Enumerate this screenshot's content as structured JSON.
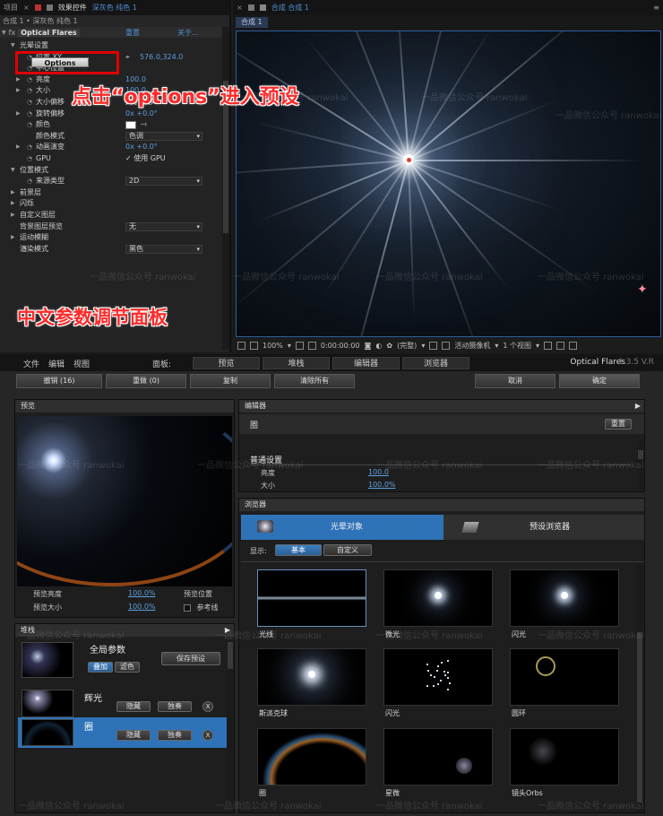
{
  "ae": {
    "tabs": {
      "project": "项目",
      "effect_controls_prefix": "效果控件",
      "effect_controls_layer": "深灰色 纯色 1"
    },
    "subtitle": "合成 1 • 深灰色 纯色 1",
    "fx": {
      "name": "Optical Flares",
      "reset": "重置",
      "about": "关于..."
    },
    "options_label": "Options",
    "params": [
      {
        "label": "光晕设置",
        "level": 1,
        "twirl": "open"
      },
      {
        "label": "位置 XY",
        "value": "576.0,324.0",
        "level": 2,
        "sw": true
      },
      {
        "label": "中心位置",
        "value": "",
        "level": 2,
        "sw": true
      },
      {
        "label": "亮度",
        "value": "100.0",
        "level": 2,
        "twirl": "closed",
        "sw": true
      },
      {
        "label": "大小",
        "value": "100.0",
        "level": 2,
        "twirl": "closed",
        "sw": true
      },
      {
        "label": "大小偏移",
        "value": "大小偏移",
        "level": 2,
        "sw": true,
        "white": true
      },
      {
        "label": "旋转偏移",
        "value": "0x +0.0°",
        "level": 2,
        "twirl": "closed",
        "sw": true
      },
      {
        "label": "颜色",
        "value": "",
        "level": 2,
        "sw": true
      },
      {
        "label": "颜色模式",
        "dropdown": "色调",
        "level": 2
      },
      {
        "label": "动画演变",
        "value": "0x +0.0°",
        "level": 2,
        "twirl": "closed",
        "sw": true
      },
      {
        "label": "GPU",
        "value": "✓ 使用 GPU",
        "level": 2,
        "sw": true,
        "white": true
      },
      {
        "label": "位置模式",
        "level": 1,
        "twirl": "open"
      },
      {
        "label": "来源类型",
        "dropdown": "2D",
        "level": 2,
        "sw": true
      },
      {
        "label": "前景层",
        "level": 1,
        "twirl": "closed"
      },
      {
        "label": "闪烁",
        "level": 1,
        "twirl": "closed"
      },
      {
        "label": "自定义图层",
        "level": 1,
        "twirl": "closed"
      },
      {
        "label": "背景图层预览",
        "dropdown": "无",
        "level": 1
      },
      {
        "label": "运动模糊",
        "level": 1,
        "twirl": "closed"
      },
      {
        "label": "渲染模式",
        "dropdown": "黑色",
        "level": 1,
        "sw": true
      }
    ],
    "annotation_options": "点击“options”进入预设",
    "annotation_panel": "中文参数调节面板",
    "comp": {
      "tab_label": "合成 合成 1",
      "subtab": "合成 1",
      "toolbar": {
        "zoom": "100%",
        "time": "0:00:00:00",
        "quality": "(完整)",
        "camera": "活动摄像机",
        "views": "1 个视图"
      }
    }
  },
  "of": {
    "menu": {
      "file": "文件",
      "edit": "编辑",
      "view": "视图",
      "panels_label": "面板:",
      "brand": "Optical Flares",
      "version": "1.3.5 V.R"
    },
    "panel_tabs": [
      "预览",
      "堆栈",
      "编辑器",
      "浏览器"
    ],
    "toolbar": {
      "undo": "撤销 (16)",
      "redo": "重做 (0)",
      "copy": "复制",
      "clear": "清除所有",
      "cancel": "取消",
      "ok": "确定"
    },
    "preview": {
      "title": "预览",
      "brightness_label": "预览亮度",
      "brightness_value": "100.0%",
      "size_label": "预览大小",
      "size_value": "100.0%",
      "position_label": "预览位置",
      "reference_label": "参考线"
    },
    "stack": {
      "title": "堆栈",
      "global": "全局参数",
      "blend_add": "叠加",
      "blend_screen": "滤色",
      "save_preset": "保存预设",
      "items": [
        {
          "name": "辉光",
          "hide": "隐藏",
          "solo": "独奏",
          "close": "X"
        },
        {
          "name": "圈",
          "hide": "隐藏",
          "solo": "独奏",
          "close": "X"
        }
      ]
    },
    "editor": {
      "title": "编辑器",
      "item": "圈",
      "reset": "重置",
      "section": "普通设置",
      "brightness_label": "亮度",
      "brightness_value": "100.0",
      "size_label": "大小",
      "size_value": "100.0%"
    },
    "browser": {
      "title": "浏览器",
      "tab_lens": "光晕对象",
      "tab_preset": "预设浏览器",
      "display_label": "显示:",
      "filter_basic": "基本",
      "filter_custom": "自定义",
      "cells": [
        "光线",
        "微光",
        "闪光",
        "斯派克球",
        "闪光",
        "圆环",
        "圈",
        "星微",
        "镜头Orbs"
      ]
    },
    "watermark": "一品微信公众号 ranwokai"
  }
}
